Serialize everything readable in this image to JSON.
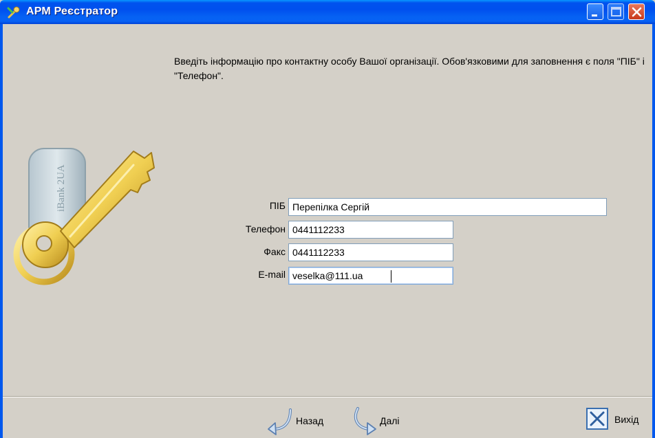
{
  "window": {
    "title": "АРМ Реєстратор",
    "icon": "app-key-icon",
    "controls": [
      "minimize-icon",
      "maximize-icon",
      "close-icon"
    ]
  },
  "instructions": "Введіть інформацію про контактну особу Вашої організації. Обов'язковими для заповнення є поля \"ПІБ\" і \"Телефон\".",
  "illustration": {
    "tag_text": "iBank 2UA",
    "icon": "key-icon"
  },
  "form": {
    "pib_label": "ПІБ",
    "pib_value": "Перепілка Сергій",
    "phone_label": "Телефон",
    "phone_value": "0441112233",
    "fax_label": "Факс",
    "fax_value": "0441112233",
    "email_label": "E-mail",
    "email_value": "veselka@111.ua"
  },
  "footer": {
    "back_label": "Назад",
    "next_label": "Далі",
    "exit_label": "Вихід"
  },
  "colors": {
    "titlebar": "#0053ee",
    "background": "#d4d0c8",
    "close_button": "#c8391a"
  }
}
